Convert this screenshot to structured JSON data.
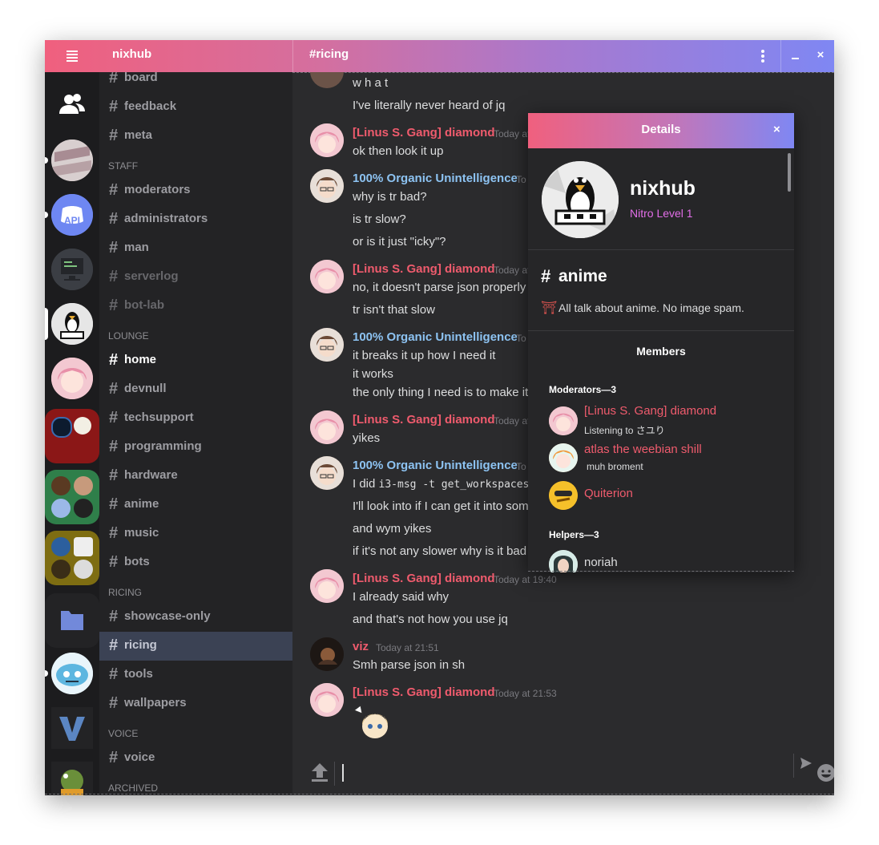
{
  "titlebar": {
    "server_name": "nixhub",
    "channel_name": "#ricing",
    "close_glyph": "×",
    "gradient": [
      "#f0607e",
      "#a779cf",
      "#7f87f3"
    ]
  },
  "channels": {
    "top": [
      {
        "label": "board"
      },
      {
        "label": "feedback"
      },
      {
        "label": "meta"
      }
    ],
    "staff_label": "STAFF",
    "staff": [
      {
        "label": "moderators"
      },
      {
        "label": "administrators"
      },
      {
        "label": "man"
      },
      {
        "label": "serverlog"
      },
      {
        "label": "bot-lab"
      }
    ],
    "lounge_label": "LOUNGE",
    "lounge": [
      {
        "label": "home"
      },
      {
        "label": "devnull"
      },
      {
        "label": "techsupport"
      },
      {
        "label": "programming"
      },
      {
        "label": "hardware"
      },
      {
        "label": "anime"
      },
      {
        "label": "music"
      },
      {
        "label": "bots"
      }
    ],
    "ricing_label": "RICING",
    "ricing": [
      {
        "label": "showcase-only"
      },
      {
        "label": "ricing"
      },
      {
        "label": "tools"
      },
      {
        "label": "wallpapers"
      }
    ],
    "voice_label": "VOICE",
    "voice": [
      {
        "label": "voice"
      }
    ],
    "archived_label": "ARCHIVED",
    "hash": "#"
  },
  "guilds": {
    "discord_api_label": "API"
  },
  "messages": {
    "g0": {
      "lines": [
        "w h a t",
        "I've literally never heard of jq"
      ]
    },
    "g1": {
      "author": "[Linus S. Gang] diamond",
      "time": "Today at",
      "lines": [
        "ok then look it up"
      ]
    },
    "g2": {
      "author": "100% Organic Unintelligence",
      "time": "To",
      "lines": [
        "why is tr bad?",
        "is tr slow?",
        "or is it just \"icky\"?"
      ]
    },
    "g3": {
      "author": "[Linus S. Gang] diamond",
      "time": "Today at",
      "lines": [
        "no, it doesn't parse json properly",
        "tr isn't that slow"
      ]
    },
    "g4": {
      "author": "100% Organic Unintelligence",
      "time": "To",
      "lines": [
        "it breaks it up how I need it",
        "it works",
        "the only thing I need is to make it fa"
      ]
    },
    "g5": {
      "author": "[Linus S. Gang] diamond",
      "time": "Today at",
      "lines": [
        "yikes"
      ]
    },
    "g6": {
      "author": "100% Organic Unintelligence",
      "time": "To",
      "line0_prefix": "I did ",
      "line0_code": "i3-msg -t get_workspaces",
      "lines": [
        "I'll look into if I can get it into some",
        "and wym yikes",
        "if it's not any slower why is it bad"
      ]
    },
    "g7": {
      "author": "[Linus S. Gang] diamond",
      "time": "Today at 19:40",
      "lines": [
        "I already said why",
        "and that's not how you use jq"
      ]
    },
    "g8": {
      "author": "viz",
      "time": "Today at 21:51",
      "lines": [
        "Smh parse json in sh"
      ]
    },
    "g9": {
      "author": "[Linus S. Gang] diamond",
      "time": "Today at 21:53"
    }
  },
  "colors": {
    "diamond": "#ef5b6d",
    "organic": "#8dc3f2",
    "viz": "#ef5b6d",
    "nitro": "#e26ee8"
  },
  "details": {
    "title": "Details",
    "close_glyph": "×",
    "server_name": "nixhub",
    "nitro": "Nitro Level 1",
    "channel_hash": "#",
    "channel": "anime",
    "topic_icon": "⛩",
    "topic": "All talk about anime. No image spam.",
    "members_label": "Members",
    "moderators_label": "Moderators—3",
    "members": [
      {
        "name": "[Linus S. Gang] diamond",
        "status": "Listening to さユり"
      },
      {
        "name": "atlas the weebian shill",
        "status": "muh broment"
      },
      {
        "name": "Quiterion",
        "status": ""
      }
    ],
    "helpers_label": "Helpers—3",
    "helpers": [
      {
        "name": "noriah"
      }
    ]
  }
}
